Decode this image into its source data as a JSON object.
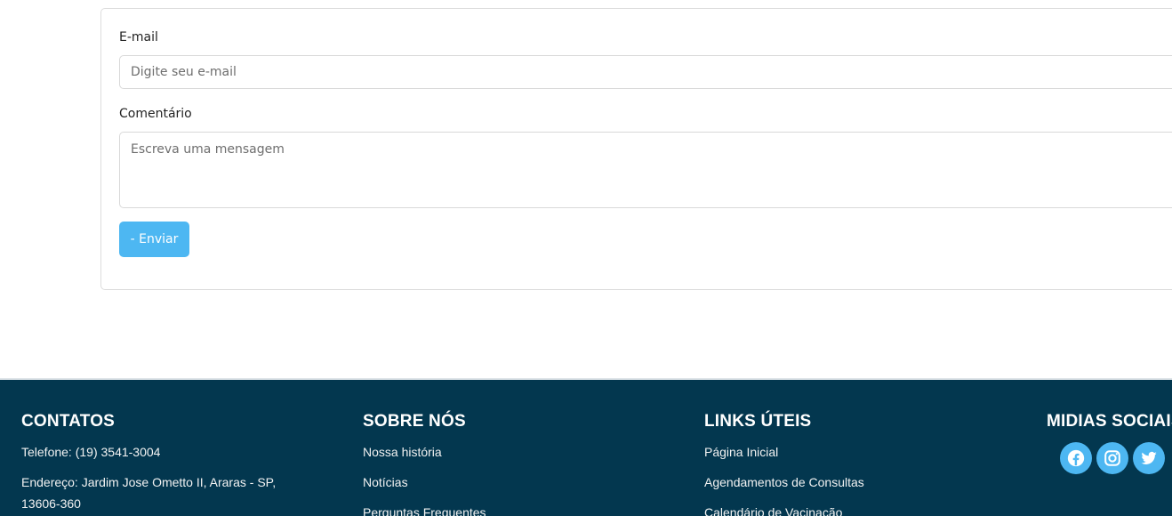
{
  "form": {
    "email_label": "E-mail",
    "email_placeholder": "Digite seu e-mail",
    "comment_label": "Comentário",
    "comment_placeholder": "Escreva uma mensagem",
    "send_button": "- Enviar"
  },
  "footer": {
    "contacts": {
      "title": "CONTATOS",
      "phone": "Telefone: (19) 3541-3004",
      "address": "Endereço: Jardim Jose Ometto II, Araras - SP, 13606-360"
    },
    "about": {
      "title": "SOBRE NÓS",
      "items": [
        "Nossa história",
        "Notícias",
        "Perguntas Frequentes"
      ]
    },
    "links": {
      "title": "LINKS ÚTEIS",
      "items": [
        "Página Inicial",
        "Agendamentos de Consultas",
        "Calendário de Vacinação"
      ]
    },
    "social": {
      "title": "MIDIAS SOCIAIS",
      "icons": [
        "facebook-icon",
        "instagram-icon",
        "twitter-icon"
      ]
    }
  },
  "colors": {
    "footer_bg": "#03374f",
    "accent": "#4db7f2"
  }
}
